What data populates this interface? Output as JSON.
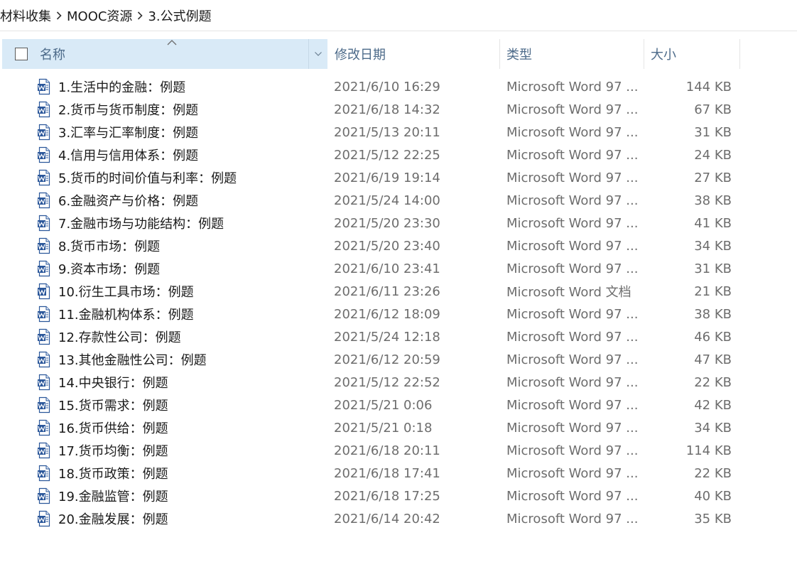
{
  "breadcrumb": {
    "items": [
      "材料收集",
      "MOOC资源",
      "3.公式例题"
    ]
  },
  "columns": {
    "name": "名称",
    "date": "修改日期",
    "type": "类型",
    "size": "大小"
  },
  "files": [
    {
      "name": "1.生活中的金融：例题",
      "date": "2021/6/10 16:29",
      "type": "Microsoft Word 97 ...",
      "size": "144 KB",
      "icon": "word-97-doc-icon"
    },
    {
      "name": "2.货币与货币制度：例题",
      "date": "2021/6/18 14:32",
      "type": "Microsoft Word 97 ...",
      "size": "67 KB",
      "icon": "word-97-doc-icon"
    },
    {
      "name": "3.汇率与汇率制度：例题",
      "date": "2021/5/13 20:11",
      "type": "Microsoft Word 97 ...",
      "size": "31 KB",
      "icon": "word-97-doc-icon"
    },
    {
      "name": "4.信用与信用体系：例题",
      "date": "2021/5/12 22:25",
      "type": "Microsoft Word 97 ...",
      "size": "24 KB",
      "icon": "word-97-doc-icon"
    },
    {
      "name": "5.货币的时间价值与利率：例题",
      "date": "2021/6/19 19:14",
      "type": "Microsoft Word 97 ...",
      "size": "27 KB",
      "icon": "word-97-doc-icon"
    },
    {
      "name": "6.金融资产与价格：例题",
      "date": "2021/5/24 14:00",
      "type": "Microsoft Word 97 ...",
      "size": "38 KB",
      "icon": "word-97-doc-icon"
    },
    {
      "name": "7.金融市场与功能结构：例题",
      "date": "2021/5/20 23:30",
      "type": "Microsoft Word 97 ...",
      "size": "41 KB",
      "icon": "word-97-doc-icon"
    },
    {
      "name": "8.货币市场：例题",
      "date": "2021/5/20 23:40",
      "type": "Microsoft Word 97 ...",
      "size": "34 KB",
      "icon": "word-97-doc-icon"
    },
    {
      "name": "9.资本市场：例题",
      "date": "2021/6/10 23:41",
      "type": "Microsoft Word 97 ...",
      "size": "31 KB",
      "icon": "word-97-doc-icon"
    },
    {
      "name": "10.衍生工具市场：例题",
      "date": "2021/6/11 23:26",
      "type": "Microsoft Word 文档",
      "size": "21 KB",
      "icon": "word-docx-icon"
    },
    {
      "name": "11.金融机构体系：例题",
      "date": "2021/6/12 18:09",
      "type": "Microsoft Word 97 ...",
      "size": "38 KB",
      "icon": "word-97-doc-icon"
    },
    {
      "name": "12.存款性公司：例题",
      "date": "2021/5/24 12:18",
      "type": "Microsoft Word 97 ...",
      "size": "46 KB",
      "icon": "word-97-doc-icon"
    },
    {
      "name": "13.其他金融性公司：例题",
      "date": "2021/6/12 20:59",
      "type": "Microsoft Word 97 ...",
      "size": "47 KB",
      "icon": "word-97-doc-icon"
    },
    {
      "name": "14.中央银行：例题",
      "date": "2021/5/12 22:52",
      "type": "Microsoft Word 97 ...",
      "size": "22 KB",
      "icon": "word-97-doc-icon"
    },
    {
      "name": "15.货币需求：例题",
      "date": "2021/5/21 0:06",
      "type": "Microsoft Word 97 ...",
      "size": "42 KB",
      "icon": "word-97-doc-icon"
    },
    {
      "name": "16.货币供给：例题",
      "date": "2021/5/21 0:18",
      "type": "Microsoft Word 97 ...",
      "size": "34 KB",
      "icon": "word-97-doc-icon"
    },
    {
      "name": "17.货币均衡：例题",
      "date": "2021/6/18 20:11",
      "type": "Microsoft Word 97 ...",
      "size": "114 KB",
      "icon": "word-97-doc-icon"
    },
    {
      "name": "18.货币政策：例题",
      "date": "2021/6/18 17:41",
      "type": "Microsoft Word 97 ...",
      "size": "22 KB",
      "icon": "word-97-doc-icon"
    },
    {
      "name": "19.金融监管：例题",
      "date": "2021/6/18 17:25",
      "type": "Microsoft Word 97 ...",
      "size": "40 KB",
      "icon": "word-97-doc-icon"
    },
    {
      "name": "20.金融发展：例题",
      "date": "2021/6/14 20:42",
      "type": "Microsoft Word 97 ...",
      "size": "35 KB",
      "icon": "word-97-doc-icon"
    }
  ],
  "colors": {
    "header_selected_bg": "#d9eaf7",
    "header_text": "#4d6b8a",
    "word_blue": "#2b579a"
  }
}
